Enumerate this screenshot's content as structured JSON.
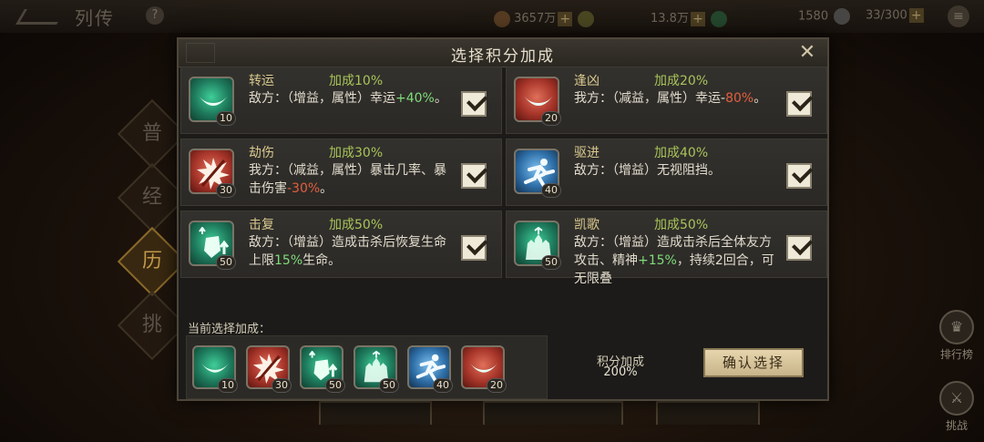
{
  "background": {
    "title": "列传",
    "help_icon_glyph": "?",
    "resource_1": "3657万",
    "resource_2": "13.8万",
    "resource_3": "1580",
    "resource_4": "33/300",
    "side_tabs": [
      "普",
      "经",
      "历",
      "挑"
    ],
    "right_buttons": [
      "排行榜",
      "挑战"
    ],
    "bottom_buttons": [
      "",
      "",
      ""
    ]
  },
  "dialog": {
    "title": "选择积分加成",
    "close_glyph": "✕",
    "cards": [
      {
        "name": "转运",
        "bonus": "加成10%",
        "desc_prefix": "敌方：（增益，属性）幸运",
        "desc_highlight": "+40%",
        "desc_suffix": "。",
        "count": "10",
        "checked": true,
        "color": "green",
        "icon": "horn-icon"
      },
      {
        "name": "逢凶",
        "bonus": "加成20%",
        "desc_prefix": "我方：（减益，属性）幸运-",
        "desc_highlight": "80%",
        "desc_suffix": "。",
        "count": "20",
        "checked": true,
        "color": "red",
        "icon": "horn-icon"
      },
      {
        "name": "劫伤",
        "bonus": "加成30%",
        "desc_prefix": "我方：（减益，属性）暴击几率、暴击伤害",
        "desc_highlight": "-30%",
        "desc_suffix": "。",
        "count": "30",
        "checked": true,
        "color": "red",
        "icon": "burst-icon"
      },
      {
        "name": "驱进",
        "bonus": "加成40%",
        "desc_prefix": "敌方：（增益）无视阻挡。",
        "desc_highlight": "",
        "desc_suffix": "",
        "count": "40",
        "checked": true,
        "color": "blue",
        "icon": "runner-icon"
      },
      {
        "name": "击复",
        "bonus": "加成50%",
        "desc_prefix": "敌方：（增益）造成击杀后恢复生命上限",
        "desc_highlight": "15%",
        "desc_suffix": "生命。",
        "count": "50",
        "checked": true,
        "color": "green",
        "icon": "shield-up-icon"
      },
      {
        "name": "凯歌",
        "bonus": "加成50%",
        "desc_prefix": "敌方：（增益）造成击杀后全体友方攻击、精神",
        "desc_highlight": "+15%",
        "desc_suffix": "，持续2回合，可无限叠",
        "count": "50",
        "checked": true,
        "color": "green",
        "icon": "crowd-icon"
      }
    ],
    "selected_label": "当前选择加成：",
    "selected": [
      {
        "count": "10",
        "color": "green",
        "icon": "horn-icon"
      },
      {
        "count": "30",
        "color": "red",
        "icon": "burst-icon"
      },
      {
        "count": "50",
        "color": "green",
        "icon": "shield-up-icon"
      },
      {
        "count": "50",
        "color": "green",
        "icon": "crowd-icon"
      },
      {
        "count": "40",
        "color": "blue",
        "icon": "runner-icon"
      },
      {
        "count": "20",
        "color": "red",
        "icon": "horn-icon"
      }
    ],
    "points_label": "积分加成",
    "points_value": "200%",
    "confirm_label": "确认选择"
  },
  "colors": {
    "accent_gold": "#d9c98f",
    "bonus_green": "#a8c45a",
    "highlight_green": "#7fdc7a",
    "highlight_red": "#e0603e",
    "confirm_bg": "#e6d5ad"
  }
}
